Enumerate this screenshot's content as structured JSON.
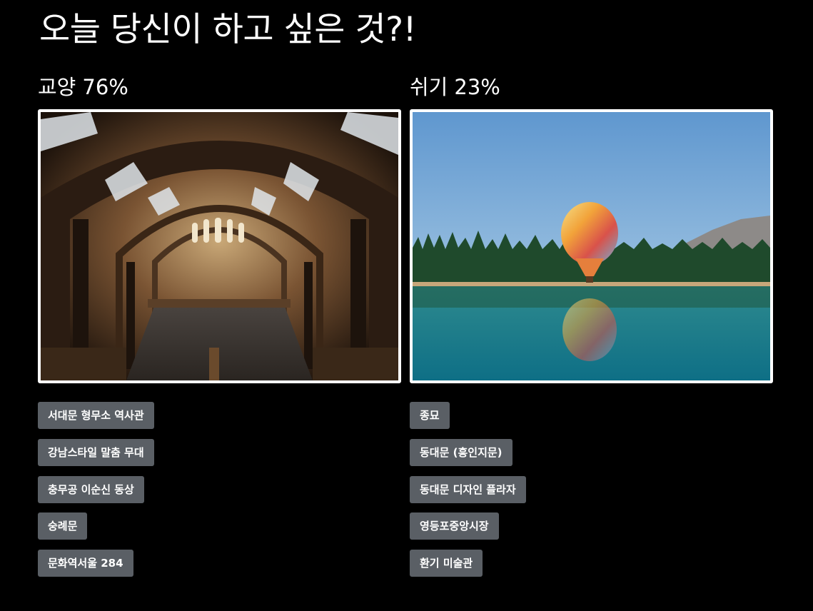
{
  "title": "오늘 당신이 하고 싶은 것?!",
  "colors": {
    "background": "#000000",
    "text": "#ffffff",
    "tag_background": "#5a5f65",
    "frame": "#ffffff"
  },
  "columns": [
    {
      "category": "교양",
      "percent": "76%",
      "image": "museum-hall-photo",
      "places": [
        "서대문 형무소 역사관",
        "강남스타일 말춤 무대",
        "충무공 이순신 동상",
        "숭례문",
        "문화역서울 284"
      ]
    },
    {
      "category": "쉬기",
      "percent": "23%",
      "image": "hot-air-balloon-lake-photo",
      "places": [
        "종묘",
        "동대문 (흥인지문)",
        "동대문 디자인 플라자",
        "영등포중앙시장",
        "환기 미술관"
      ]
    }
  ]
}
